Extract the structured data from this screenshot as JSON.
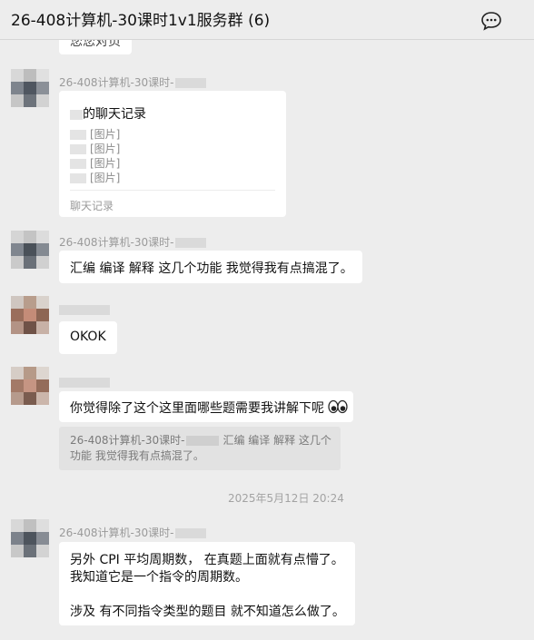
{
  "header": {
    "title": "26-408计算机-30课时1v1服务群 (6)",
    "chat_icon": "chat-bubble-icon"
  },
  "top_partial_text": "您您对页",
  "messages": [
    {
      "sender": "26-408计算机-30课时-",
      "card": {
        "title_suffix": "的聊天记录",
        "lines": [
          "[图片]",
          "[图片]",
          "[图片]",
          "[图片]"
        ],
        "footer": "聊天记录"
      }
    },
    {
      "sender": "26-408计算机-30课时-",
      "text": "汇编 编译 解释 这几个功能 我觉得我有点搞混了。"
    },
    {
      "sender": "",
      "text": "OKOK"
    },
    {
      "sender": "",
      "text": "你觉得除了这个这里面哪些题需要我讲解下呢",
      "quote": {
        "sender": "26-408计算机-30课时-",
        "line1": "汇编 编译 解释 这几个",
        "line2": "功能 我觉得我有点搞混了。"
      }
    },
    {
      "timestamp": "2025年5月12日 20:24"
    },
    {
      "sender": "26-408计算机-30课时-",
      "lines": [
        "另外 CPI 平均周期数， 在真题上面就有点懵了。",
        "我知道它是一个指令的周期数。",
        "",
        "涉及 有不同指令类型的题目 就不知道怎么做了。"
      ]
    }
  ]
}
